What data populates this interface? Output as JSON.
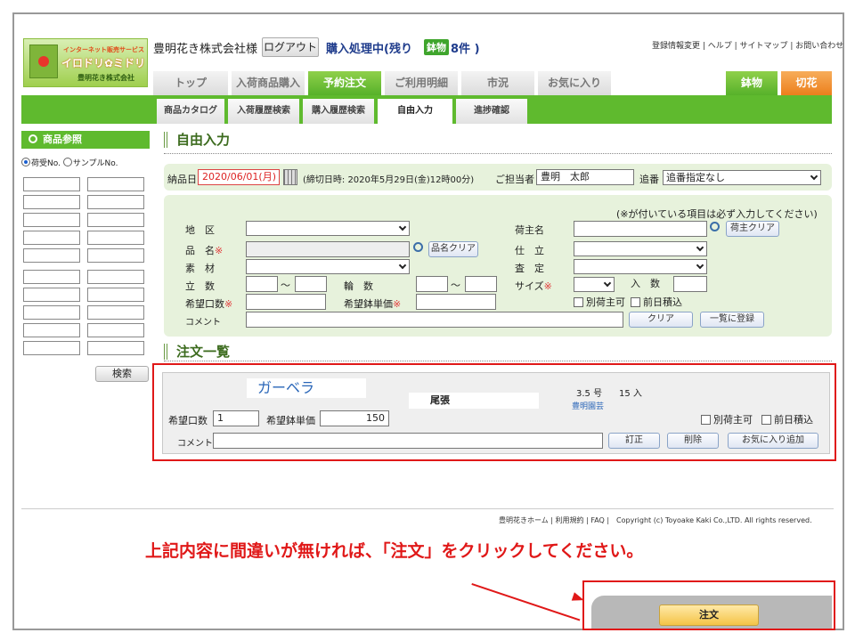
{
  "header": {
    "logo_top": "インターネット販売サービス",
    "logo_main": "イロドリ✿ミドリ",
    "logo_sub": "豊明花き株式会社",
    "company": "豊明花き株式会社様",
    "logout": "ログアウト",
    "status": "購入処理中(残り",
    "pot_badge": "鉢物",
    "count": "8件 )",
    "links": "登録情報変更 | ヘルプ | サイトマップ | お問い合わせ"
  },
  "tabs": [
    "トップ",
    "入荷商品購入",
    "予約注文",
    "ご利用明細",
    "市況",
    "お気に入り"
  ],
  "right_tabs": [
    "鉢物",
    "切花"
  ],
  "subtabs": [
    "商品カタログ",
    "入荷履歴検索",
    "購入履歴検索",
    "自由入力",
    "進捗確認"
  ],
  "sidebar": {
    "title": "商品参照",
    "radio1": "荷受No.",
    "radio2": "サンプルNo.",
    "search": "検索"
  },
  "free_input": {
    "title": "自由入力",
    "delivery_label": "納品日",
    "delivery_value": "2020/06/01(月)",
    "deadline": "(締切日時: 2020年5月29日(金)12時00分)",
    "person_label": "ご担当者",
    "person_value": "豊明　太郎",
    "seq_label": "追番",
    "seq_value": "追番指定なし"
  },
  "form": {
    "note": "(※が付いている項目は必ず入力してください)",
    "area": "地　区",
    "item": "品　名",
    "material": "素　材",
    "stand": "立　数",
    "wheel": "輪　数",
    "desired_qty": "希望口数",
    "desired_price": "希望鉢単価",
    "comment": "コメント",
    "shipper": "荷主名",
    "finish": "仕　立",
    "grade": "査　定",
    "size": "サイズ",
    "irisuu": "入　数",
    "item_clear": "品名クリア",
    "shipper_clear": "荷主クリア",
    "tilde": "～",
    "separate_shipper": "別荷主可",
    "prev_day": "前日積込",
    "clear": "クリア",
    "register": "一覧に登録"
  },
  "order_list": {
    "title": "注文一覧",
    "product": "ガーベラ",
    "origin": "尾張",
    "size": "3.5",
    "size_unit": "号",
    "irisuu": "15",
    "irisuu_unit": "入",
    "producer": "豊明園芸",
    "qty_label": "希望口数",
    "qty_value": "1",
    "price_label": "希望鉢単価",
    "price_value": "150",
    "separate_shipper": "別荷主可",
    "prev_day": "前日積込",
    "comment_label": "コメント",
    "edit": "訂正",
    "delete": "削除",
    "favorite": "お気に入り追加"
  },
  "footer": "豊明花きホーム | 利用規約 | FAQ |　Copyright (c) Toyoake Kaki Co.,LTD. All rights reserved.",
  "instruction": "上記内容に間違いが無ければ、「注文」をクリックしてください。",
  "order_button": "注文",
  "colors": {
    "green": "#5fba2e",
    "orange": "#ec7f1c",
    "red_annotation": "#e01818"
  }
}
